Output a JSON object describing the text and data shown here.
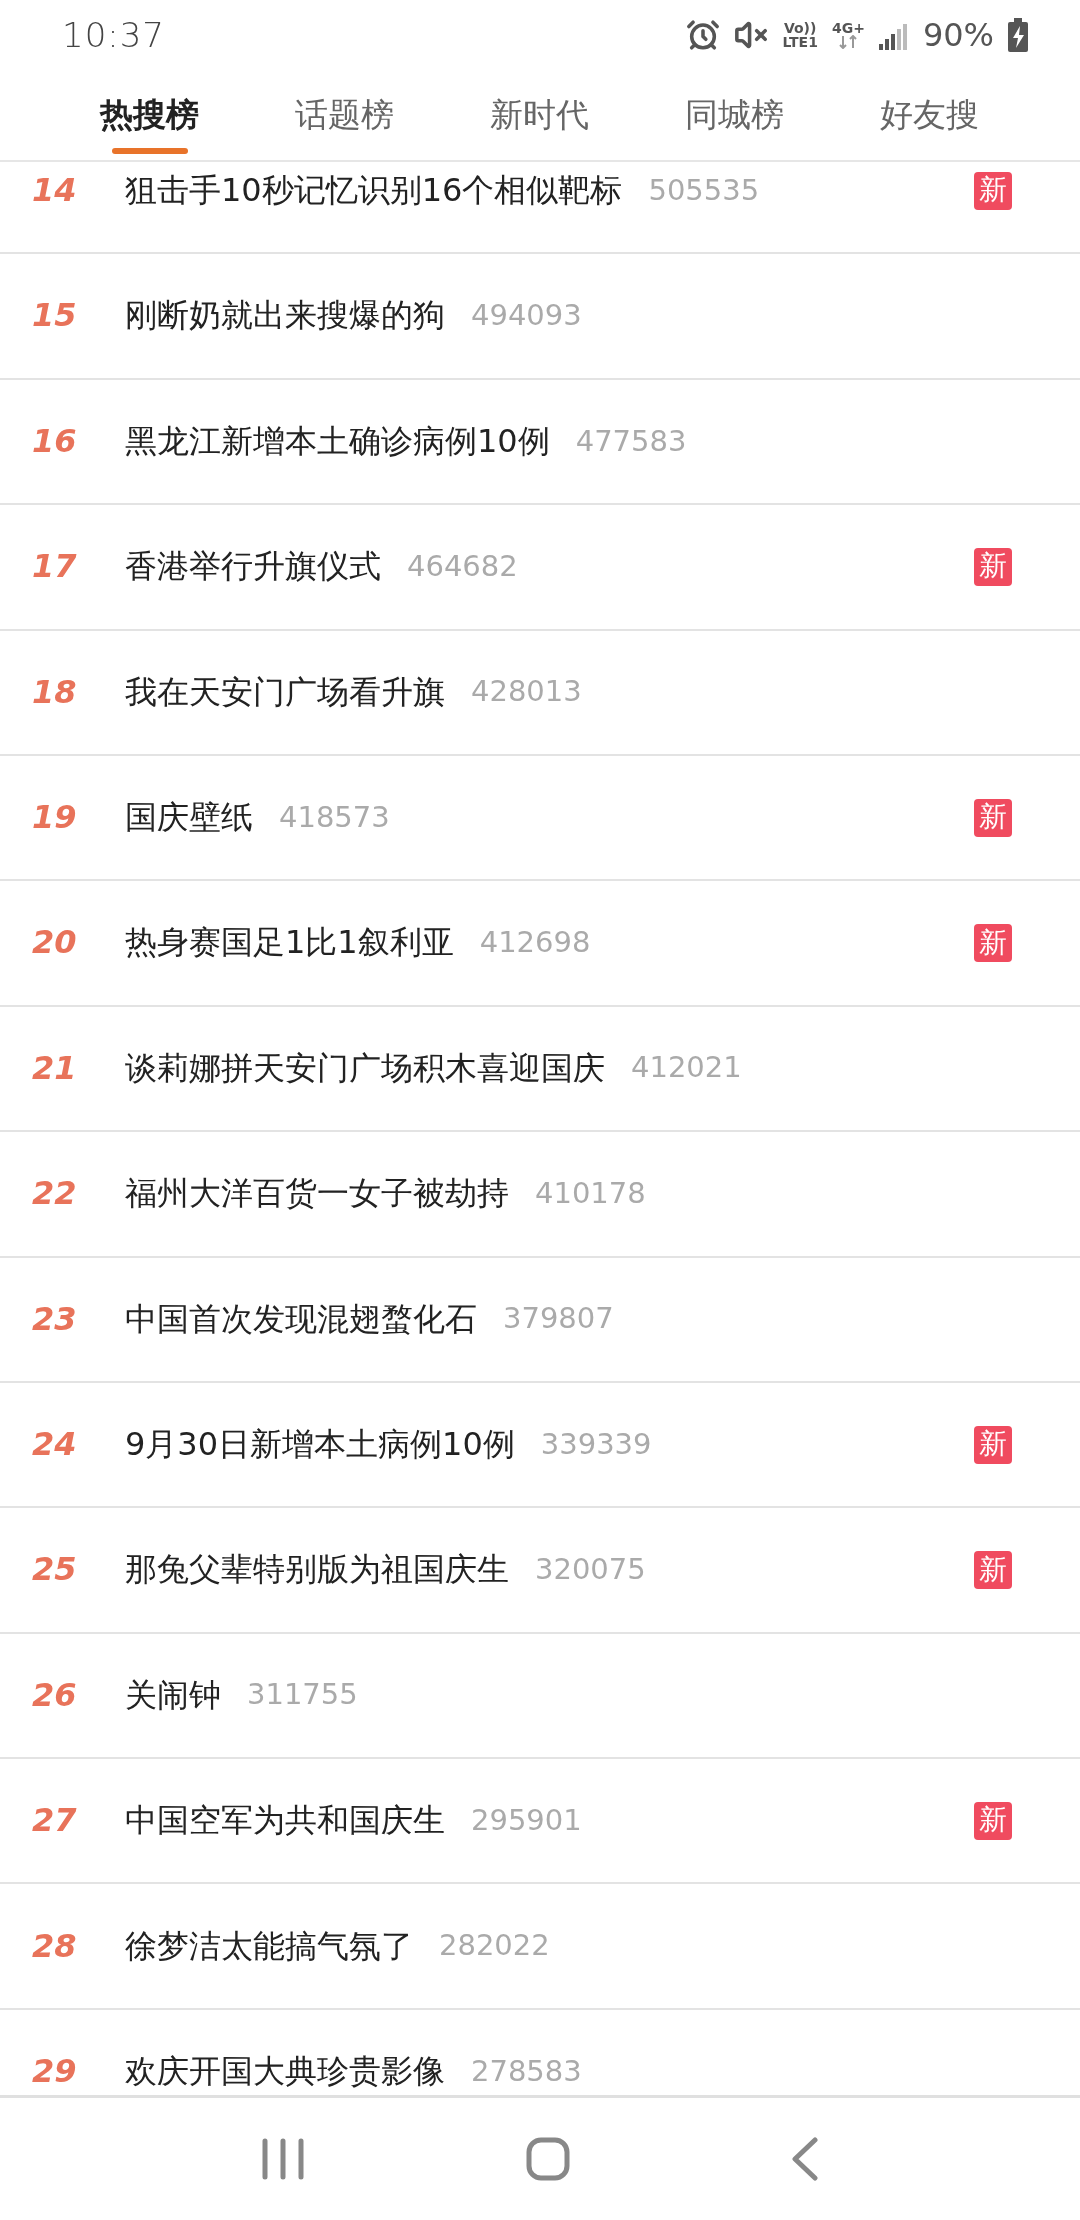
{
  "status_bar": {
    "time": "10:37",
    "volte": "Vo))",
    "lte": "LTE1",
    "network": "4G+",
    "battery": "90%"
  },
  "tabs": [
    {
      "label": "热搜榜",
      "selected": true
    },
    {
      "label": "话题榜",
      "selected": false
    },
    {
      "label": "新时代",
      "selected": false
    },
    {
      "label": "同城榜",
      "selected": false
    },
    {
      "label": "好友搜",
      "selected": false
    }
  ],
  "rows": [
    {
      "rank": "14",
      "title": "狙击手10秒记忆识别16个相似靶标",
      "count": "505535",
      "badge": "新"
    },
    {
      "rank": "15",
      "title": "刚断奶就出来搜爆的狗",
      "count": "494093"
    },
    {
      "rank": "16",
      "title": "黑龙江新增本土确诊病例10例",
      "count": "477583"
    },
    {
      "rank": "17",
      "title": "香港举行升旗仪式",
      "count": "464682",
      "badge": "新"
    },
    {
      "rank": "18",
      "title": "我在天安门广场看升旗",
      "count": "428013"
    },
    {
      "rank": "19",
      "title": "国庆壁纸",
      "count": "418573",
      "badge": "新"
    },
    {
      "rank": "20",
      "title": "热身赛国足1比1叙利亚",
      "count": "412698",
      "badge": "新"
    },
    {
      "rank": "21",
      "title": "谈莉娜拼天安门广场积木喜迎国庆",
      "count": "412021"
    },
    {
      "rank": "22",
      "title": "福州大洋百货一女子被劫持",
      "count": "410178"
    },
    {
      "rank": "23",
      "title": "中国首次发现混翅蝥化石",
      "count": "379807"
    },
    {
      "rank": "24",
      "title": "9月30日新增本土病例10例",
      "count": "339339",
      "badge": "新"
    },
    {
      "rank": "25",
      "title": "那兔父辈特别版为祖国庆生",
      "count": "320075",
      "badge": "新"
    },
    {
      "rank": "26",
      "title": "关闹钟",
      "count": "311755"
    },
    {
      "rank": "27",
      "title": "中国空军为共和国庆生",
      "count": "295901",
      "badge": "新"
    },
    {
      "rank": "28",
      "title": "徐梦洁太能搞气氛了",
      "count": "282022"
    },
    {
      "rank": "29",
      "title": "欢庆开国大典珍贵影像",
      "count": "278583"
    }
  ]
}
